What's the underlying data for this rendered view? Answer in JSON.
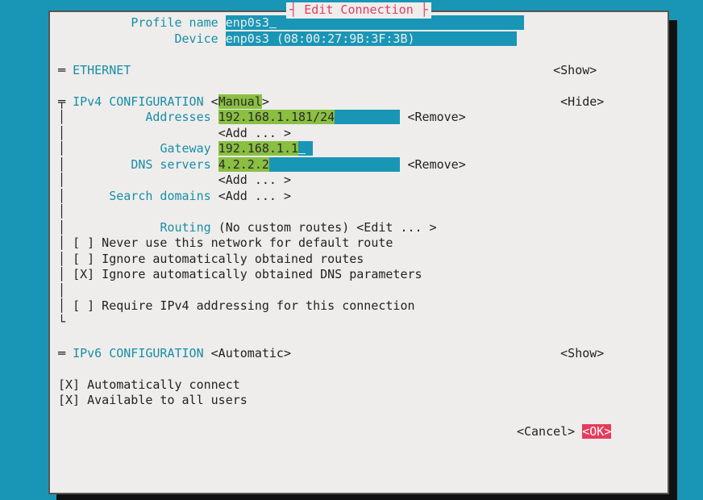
{
  "title": "Edit Connection",
  "fields": {
    "profile_name_label": "Profile name",
    "profile_name_value": "enp0s3",
    "device_label": "Device",
    "device_value": "enp0s3 (08:00:27:9B:3F:3B)"
  },
  "sections": {
    "ethernet": {
      "label": "ETHERNET",
      "toggle": "<Show>"
    },
    "ipv4": {
      "label": "IPv4 CONFIGURATION",
      "mode_open": "<",
      "mode": "Manual",
      "mode_close": ">",
      "toggle": "<Hide>",
      "addresses_label": "Addresses",
      "address_value": "192.168.1.181/24",
      "remove": "<Remove>",
      "add": "<Add ... >",
      "gateway_label": "Gateway",
      "gateway_value": "192.168.1.1",
      "dns_label": "DNS servers",
      "dns_value": "4.2.2.2",
      "search_domains_label": "Search domains",
      "routing_label": "Routing",
      "routing_value": "(No custom routes)",
      "routing_edit": "<Edit ... >",
      "cb_never_default": "[ ] Never use this network for default route",
      "cb_ignore_routes": "[ ] Ignore automatically obtained routes",
      "cb_ignore_dns": "[X] Ignore automatically obtained DNS parameters",
      "cb_require": "[ ] Require IPv4 addressing for this connection"
    },
    "ipv6": {
      "label": "IPv6 CONFIGURATION",
      "mode": "<Automatic>",
      "toggle": "<Show>"
    }
  },
  "footer": {
    "auto_connect": "[X] Automatically connect",
    "all_users": "[X] Available to all users",
    "cancel": "<Cancel>",
    "ok": "<OK>"
  }
}
